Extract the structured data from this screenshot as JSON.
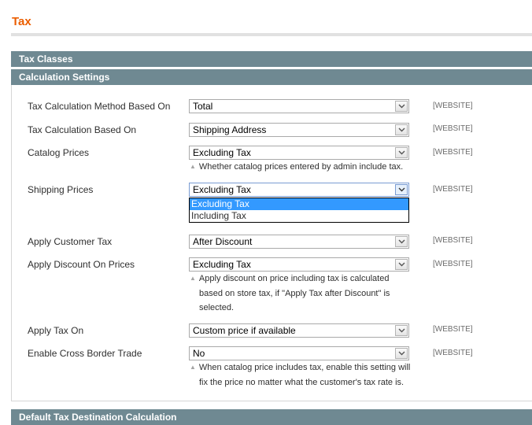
{
  "page": {
    "title": "Tax"
  },
  "sections": {
    "tax_classes": "Tax Classes",
    "calculation_settings": "Calculation Settings",
    "default_destination": "Default Tax Destination Calculation"
  },
  "rows": [
    {
      "label": "Tax Calculation Method Based On",
      "value": "Total",
      "scope": "[WEBSITE]"
    },
    {
      "label": "Tax Calculation Based On",
      "value": "Shipping Address",
      "scope": "[WEBSITE]"
    },
    {
      "label": "Catalog Prices",
      "value": "Excluding Tax",
      "scope": "[WEBSITE]",
      "note": [
        "Whether catalog prices entered by admin include tax."
      ]
    },
    {
      "label": "Shipping Prices",
      "value": "Excluding Tax",
      "scope": "[WEBSITE]"
    },
    {
      "label": "Apply Customer Tax",
      "value": "After Discount",
      "scope": "[WEBSITE]"
    },
    {
      "label": "Apply Discount On Prices",
      "value": "Excluding Tax",
      "scope": "[WEBSITE]",
      "note": [
        "Apply discount on price including tax is calculated",
        "based on store tax, if \"Apply Tax after Discount\" is",
        "selected."
      ]
    },
    {
      "label": "Apply Tax On",
      "value": "Custom price if available",
      "scope": "[WEBSITE]"
    },
    {
      "label": "Enable Cross Border Trade",
      "value": "No",
      "scope": "[WEBSITE]",
      "note": [
        "When catalog price includes tax, enable this setting will",
        "fix the price no matter what the customer's tax rate is."
      ]
    }
  ],
  "shipping_prices_dropdown": {
    "options": [
      "Excluding Tax",
      "Including Tax"
    ],
    "selected_index": 0
  },
  "icons": {
    "note": "triangle-up-icon",
    "select_arrow": "chevron-down-icon"
  },
  "colors": {
    "title": "#eb5e00",
    "section_header": "#6f8992",
    "selected_option": "#3399ff"
  }
}
